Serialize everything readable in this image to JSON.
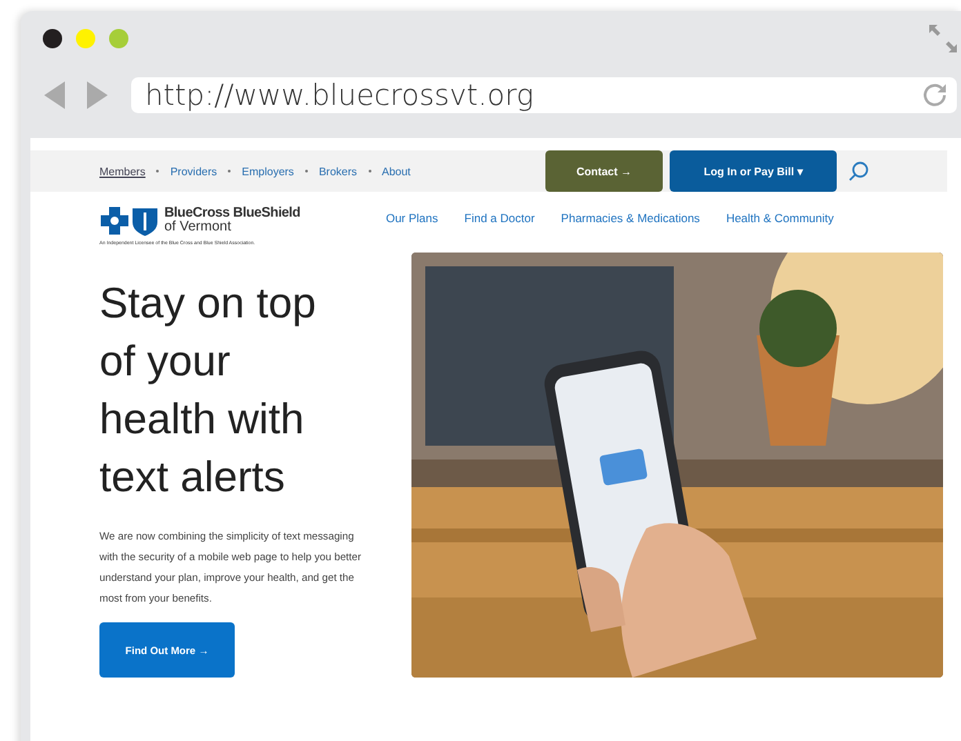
{
  "browser": {
    "url": "http://www.bluecrossvt.org"
  },
  "top_nav": {
    "links": [
      {
        "label": "Members",
        "selected": true
      },
      {
        "label": "Providers",
        "selected": false
      },
      {
        "label": "Employers",
        "selected": false
      },
      {
        "label": "Brokers",
        "selected": false
      },
      {
        "label": "About",
        "selected": false
      }
    ],
    "contact_button": "Contact →",
    "login_button": "Log In or Pay Bill ▾"
  },
  "logo": {
    "name": "BlueCross BlueShield",
    "region": "of Vermont",
    "tagline": "An Independent Licensee of the Blue Cross and Blue Shield Association."
  },
  "main_nav": [
    "Our Plans",
    "Find a Doctor",
    "Pharmacies & Medications",
    "Health & Community"
  ],
  "hero": {
    "headline": "Stay on top of your health with text alerts",
    "body": "We are now combining the simplicity of text messaging with the security of a mobile web page to help you better understand your plan, improve your health, and get the most from your benefits.",
    "button": "Find Out More →"
  }
}
